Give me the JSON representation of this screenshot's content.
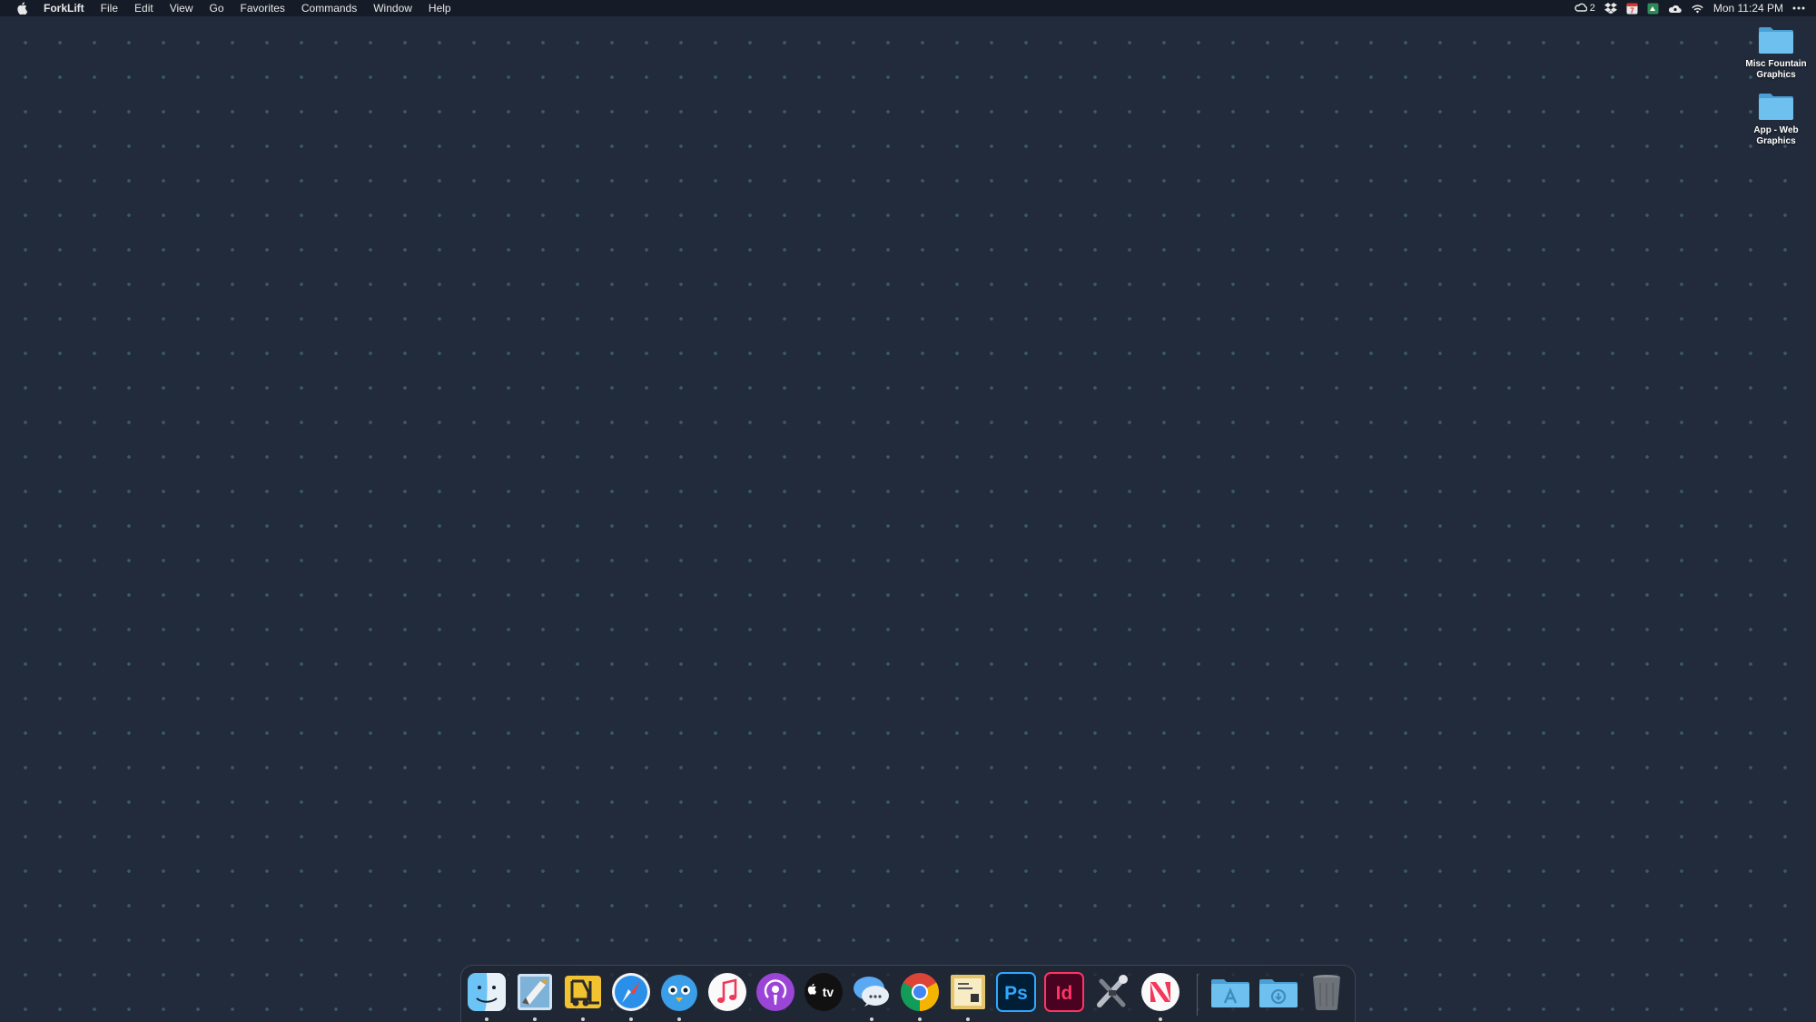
{
  "menubar": {
    "app_name": "ForkLift",
    "items": [
      "File",
      "Edit",
      "View",
      "Go",
      "Favorites",
      "Commands",
      "Window",
      "Help"
    ],
    "status": {
      "creative_cloud_count": "2",
      "calendar_day": "7",
      "clock": "Mon 11:24 PM",
      "icons": [
        "creative-cloud-icon",
        "dropbox-icon",
        "calendar-icon",
        "screen-icon",
        "cloud-icon",
        "wifi-icon",
        "more-icon"
      ]
    }
  },
  "desktop": {
    "items": [
      {
        "label": "Misc Fountain Graphics",
        "icon": "folder-icon"
      },
      {
        "label": "App - Web Graphics",
        "icon": "folder-icon"
      }
    ]
  },
  "dock": {
    "apps": [
      {
        "name": "Finder",
        "icon": "finder-icon",
        "running": true
      },
      {
        "name": "Mail",
        "icon": "mail-icon",
        "running": true
      },
      {
        "name": "ForkLift",
        "icon": "forklift-icon",
        "running": true
      },
      {
        "name": "Safari",
        "icon": "safari-icon",
        "running": true
      },
      {
        "name": "Tweetbot",
        "icon": "tweetbot-icon",
        "running": true
      },
      {
        "name": "Music",
        "icon": "music-icon",
        "running": false
      },
      {
        "name": "Podcasts",
        "icon": "podcasts-icon",
        "running": false
      },
      {
        "name": "TV",
        "icon": "appletv-icon",
        "running": false
      },
      {
        "name": "Messages",
        "icon": "messages-icon",
        "running": true
      },
      {
        "name": "Google Chrome",
        "icon": "chrome-icon",
        "running": true
      },
      {
        "name": "Stamps",
        "icon": "stamps-icon",
        "running": true
      },
      {
        "name": "Photoshop",
        "icon": "photoshop-icon",
        "running": false
      },
      {
        "name": "InDesign",
        "icon": "indesign-icon",
        "running": false
      },
      {
        "name": "System Utility",
        "icon": "tools-icon",
        "running": false
      },
      {
        "name": "News",
        "icon": "news-icon",
        "running": true
      }
    ],
    "folders": [
      {
        "name": "Applications",
        "icon": "applications-folder-icon"
      },
      {
        "name": "Downloads",
        "icon": "downloads-folder-icon"
      },
      {
        "name": "Trash",
        "icon": "trash-icon"
      }
    ],
    "photoshop_text": "Ps",
    "indesign_text": "Id",
    "tv_text": "tv"
  },
  "colors": {
    "desktop_bg": "#222b3b",
    "menubar_bg": "#151b27",
    "folder_blue": "#5fb3e4",
    "photoshop": "#31a8ff",
    "indesign": "#ff3366"
  }
}
